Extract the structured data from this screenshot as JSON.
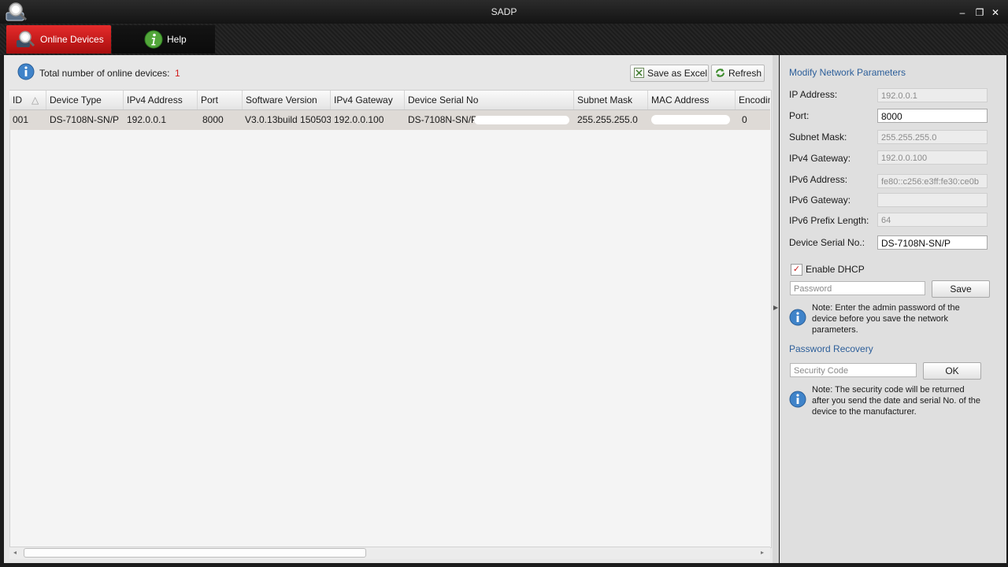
{
  "window": {
    "title": "SADP",
    "minimize": "–",
    "restore": "❐",
    "close": "✕"
  },
  "nav": {
    "online_devices": "Online Devices",
    "help": "Help"
  },
  "toolbar": {
    "count_label": "Total number of online devices:",
    "count_value": "1",
    "save_excel": "Save as Excel",
    "refresh": "Refresh"
  },
  "table": {
    "headers": [
      "ID",
      "Device Type",
      "IPv4 Address",
      "Port",
      "Software Version",
      "IPv4 Gateway",
      "Device Serial No",
      "Subnet Mask",
      "MAC Address",
      "Encoding"
    ],
    "sort_indicator": "△",
    "rows": [
      {
        "id": "001",
        "device_type": "DS-7108N-SN/P",
        "ipv4": "192.0.0.1",
        "port": "8000",
        "software": "V3.0.13build 150503",
        "gateway": "192.0.0.100",
        "serial": "DS-7108N-SN/P",
        "subnet": "255.255.255.0",
        "mac": "",
        "encoding": "0"
      }
    ]
  },
  "modify": {
    "title": "Modify Network Parameters",
    "ip_label": "IP Address:",
    "ip_value": "192.0.0.1",
    "port_label": "Port:",
    "port_value": "8000",
    "subnet_label": "Subnet Mask:",
    "subnet_value": "255.255.255.0",
    "gateway_label": "IPv4 Gateway:",
    "gateway_value": "192.0.0.100",
    "ipv6_label": "IPv6 Address:",
    "ipv6_value": "fe80::c256:e3ff:fe30:ce0b",
    "ipv6_gateway_label": "IPv6 Gateway:",
    "ipv6_gateway_value": "",
    "ipv6_prefix_label": "IPv6 Prefix Length:",
    "ipv6_prefix_value": "64",
    "serial_label": "Device Serial No.:",
    "serial_value": "DS-7108N-SN/P",
    "dhcp_label": "Enable DHCP",
    "dhcp_checked": "✓",
    "password_placeholder": "Password",
    "save": "Save",
    "note": "Note: Enter the admin password of the device before you save the network parameters."
  },
  "recovery": {
    "title": "Password Recovery",
    "code_placeholder": "Security Code",
    "ok": "OK",
    "note": "Note: The security code will be returned after you send the date and serial No. of the device to the manufacturer."
  },
  "icons": {
    "app": "magnifier-monitor-icon",
    "online": "magnifier-icon",
    "help": "info-icon",
    "excel": "excel-icon",
    "refresh": "refresh-icon",
    "note": "info-icon"
  },
  "colors": {
    "accent_red": "#d21b1b",
    "tab_red": "#c81c1c",
    "section_blue": "#2d5f9a"
  }
}
